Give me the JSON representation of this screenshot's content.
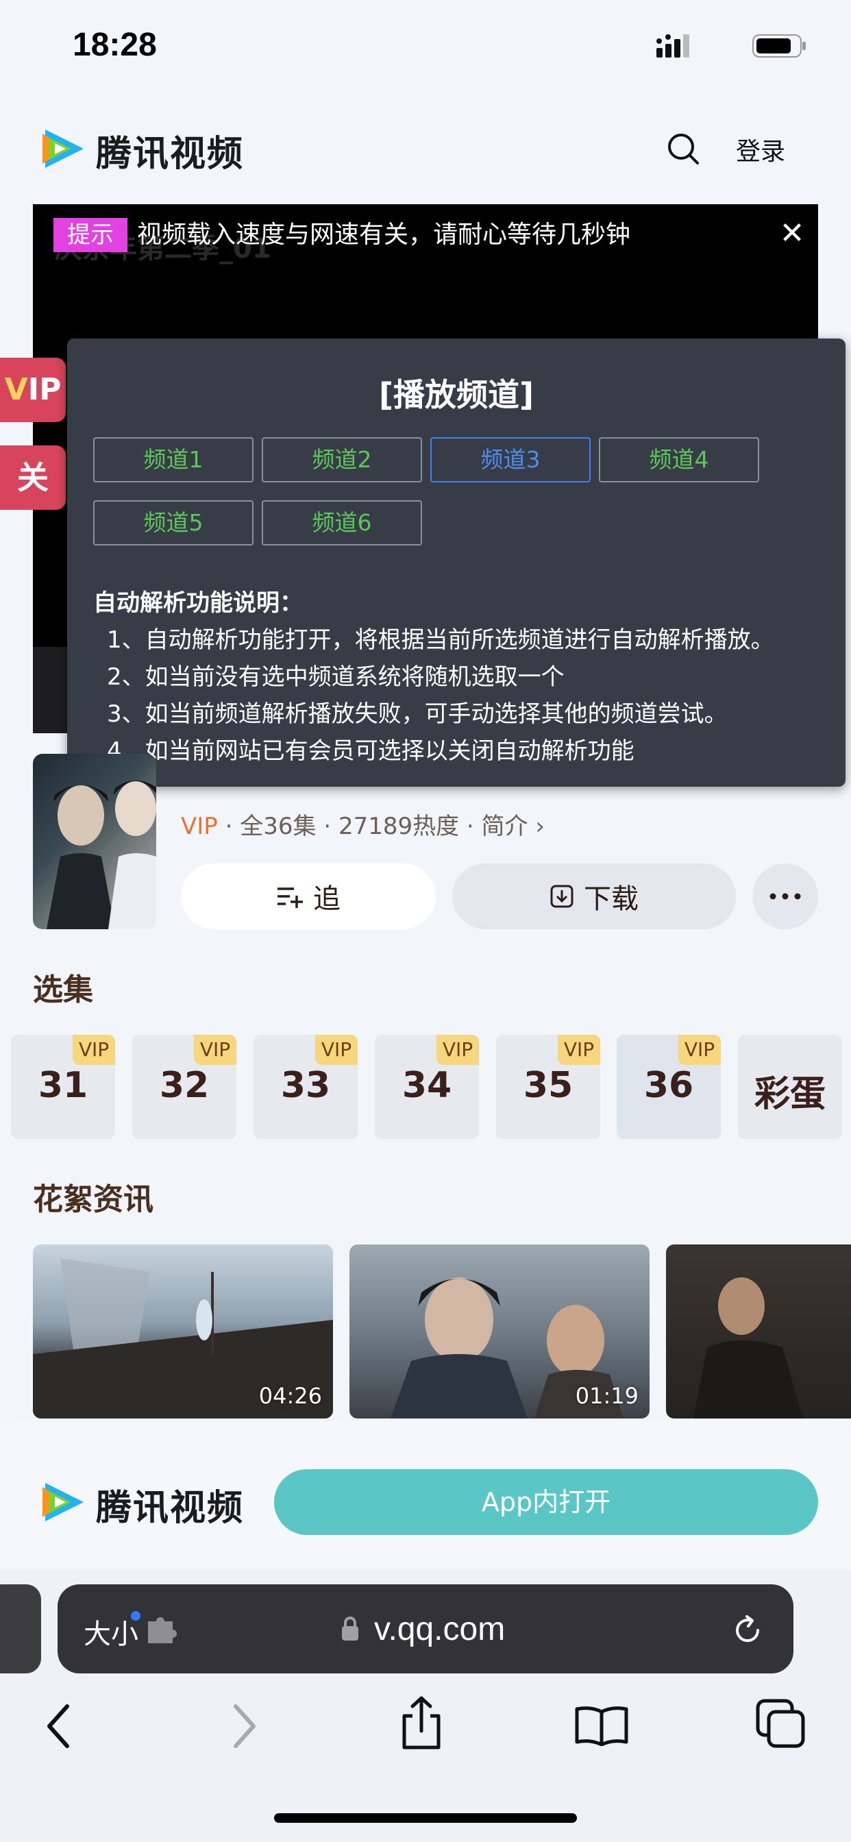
{
  "status": {
    "time": "18:28"
  },
  "header": {
    "brand": "腾讯视频",
    "login": "登录"
  },
  "video": {
    "title_behind": "庆余年第二季_01",
    "hint_tag": "提示",
    "hint_text": "视频载入速度与网速有关，请耐心等待几秒钟",
    "close": "✕"
  },
  "panel": {
    "title": "[播放频道]",
    "channels": [
      "频道1",
      "频道2",
      "频道3",
      "频道4",
      "频道5",
      "频道6"
    ],
    "active_channel": "频道3",
    "notes_title": "自动解析功能说明：",
    "notes": [
      "1、自动解析功能打开，将根据当前所选频道进行自动解析播放。",
      "2、如当前没有选中频道系统将随机选取一个",
      "3、如当前频道解析播放失败，可手动选择其他的频道尝试。",
      "4、如当前网站已有会员可选择以关闭自动解析功能"
    ]
  },
  "side": {
    "vip_v": "V",
    "vip_ip": "IP",
    "guan": "关"
  },
  "show": {
    "vip": "VIP",
    "sep": "·",
    "episodes": "全36集",
    "heat": "27189热度",
    "intro": "简介",
    "follow": "追",
    "download": "下载"
  },
  "episodes_section": {
    "title": "选集",
    "items": [
      {
        "num": "31",
        "badge": "VIP"
      },
      {
        "num": "32",
        "badge": "VIP"
      },
      {
        "num": "33",
        "badge": "VIP"
      },
      {
        "num": "34",
        "badge": "VIP"
      },
      {
        "num": "35",
        "badge": "VIP"
      },
      {
        "num": "36",
        "badge": "VIP"
      },
      {
        "num": "彩蛋",
        "badge": ""
      }
    ]
  },
  "news_section": {
    "title": "花絮资讯",
    "items": [
      {
        "duration": "04:26"
      },
      {
        "duration": "01:19"
      },
      {
        "duration": ""
      }
    ]
  },
  "banner": {
    "brand": "腾讯视频",
    "open_app": "App内打开"
  },
  "safari": {
    "text_size": "大小",
    "url": "v.qq.com"
  },
  "colors": {
    "accent": "#5bc6c6",
    "vip_orange": "#e8742e",
    "channel_green": "#5cc85a",
    "channel_active": "#4a8ff0",
    "hint_pink": "#e342e3"
  }
}
